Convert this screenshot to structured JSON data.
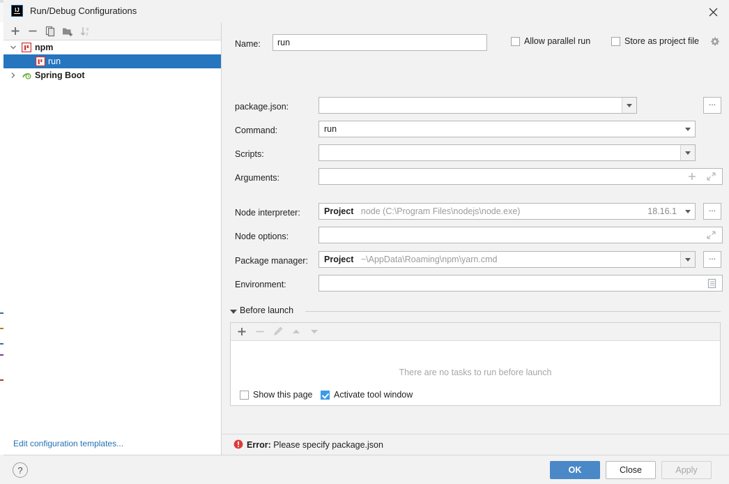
{
  "window": {
    "title": "Run/Debug Configurations",
    "app_icon": "intellij-idea-icon",
    "close_icon": "close-icon"
  },
  "left_panel": {
    "toolbar": [
      {
        "name": "add-configuration-button",
        "icon": "plus-icon",
        "enabled": true
      },
      {
        "name": "remove-configuration-button",
        "icon": "minus-icon",
        "enabled": true
      },
      {
        "name": "copy-configuration-button",
        "icon": "copy-icon",
        "enabled": true
      },
      {
        "name": "new-folder-button",
        "icon": "folder-plus-icon",
        "enabled": true
      },
      {
        "name": "sort-configurations-button",
        "icon": "sort-az-icon",
        "enabled": false
      }
    ],
    "tree": [
      {
        "label": "npm",
        "icon": "npm-icon",
        "expanded": true,
        "depth": 0,
        "bold": true,
        "selected": false,
        "has_arrow": true
      },
      {
        "label": "run",
        "icon": "npm-script-icon",
        "expanded": false,
        "depth": 1,
        "bold": false,
        "selected": true,
        "has_arrow": false
      },
      {
        "label": "Spring Boot",
        "icon": "spring-boot-icon",
        "expanded": false,
        "depth": 0,
        "bold": true,
        "selected": false,
        "has_arrow": true
      }
    ],
    "edit_templates_link": "Edit configuration templates..."
  },
  "form": {
    "name_label": "Name:",
    "name_value": "run",
    "allow_parallel_run": {
      "label": "Allow parallel run",
      "checked": false
    },
    "store_as_project_file": {
      "label": "Store as project file",
      "checked": false,
      "gear_icon": "gear-icon"
    },
    "package_json": {
      "label": "package.json:",
      "value": "",
      "browse_label": "...",
      "dropdown_icon": "chevron-down-icon"
    },
    "command": {
      "label": "Command:",
      "value": "run",
      "dropdown_icon": "chevron-down-icon"
    },
    "scripts": {
      "label": "Scripts:",
      "value": "",
      "dropdown_icon": "chevron-down-icon"
    },
    "arguments": {
      "label": "Arguments:",
      "value": "",
      "add_icon": "plus-icon",
      "expand_icon": "expand-icon"
    },
    "node_interpreter": {
      "label": "Node interpreter:",
      "scope": "Project",
      "path": "node (C:\\Program Files\\nodejs\\node.exe)",
      "version": "18.16.1",
      "browse_label": "...",
      "dropdown_icon": "chevron-down-icon"
    },
    "node_options": {
      "label": "Node options:",
      "value": "",
      "expand_icon": "expand-icon"
    },
    "package_manager": {
      "label": "Package manager:",
      "scope": "Project",
      "path": "~\\AppData\\Roaming\\npm\\yarn.cmd",
      "browse_label": "...",
      "dropdown_icon": "chevron-down-icon"
    },
    "environment": {
      "label": "Environment:",
      "value": "",
      "editor_icon": "list-editor-icon"
    }
  },
  "before_launch": {
    "title": "Before launch",
    "collapse_icon": "triangle-down-icon",
    "toolbar": [
      {
        "name": "add-task-button",
        "icon": "plus-icon",
        "enabled": true
      },
      {
        "name": "remove-task-button",
        "icon": "minus-icon",
        "enabled": false
      },
      {
        "name": "edit-task-button",
        "icon": "pencil-icon",
        "enabled": false
      },
      {
        "name": "move-task-up-button",
        "icon": "arrow-up-icon",
        "enabled": false
      },
      {
        "name": "move-task-down-button",
        "icon": "arrow-down-icon",
        "enabled": false
      }
    ],
    "empty_message": "There are no tasks to run before launch",
    "show_this_page": {
      "label": "Show this page",
      "checked": false
    },
    "activate_tool_window": {
      "label": "Activate tool window",
      "checked": true
    }
  },
  "status": {
    "error_icon": "error-icon",
    "error_prefix": "Error:",
    "error_message": "Please specify package.json"
  },
  "footer": {
    "help_label": "?",
    "ok_label": "OK",
    "close_label": "Close",
    "apply_label": "Apply",
    "apply_enabled": false
  },
  "colors": {
    "accent_blue": "#4a88c7",
    "selection_blue": "#2675bf",
    "checkbox_blue": "#3c9ae8",
    "link_blue": "#2470b3",
    "error_red": "#db3b3b",
    "dialog_bg": "#f2f2f2",
    "panel_bg": "#ffffff"
  }
}
